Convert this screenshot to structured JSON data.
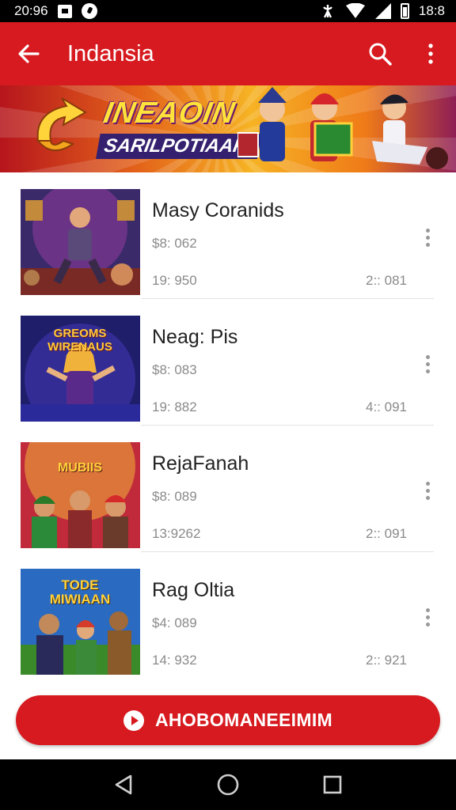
{
  "status_bar": {
    "time_left": "20:96",
    "time_right": "18:8"
  },
  "app_bar": {
    "title": "Indansia",
    "icons": [
      "back-arrow-icon",
      "search-icon",
      "more-vert-icon"
    ]
  },
  "banner": {
    "line1": "INEAOIN",
    "line2": "SARILPOTIAAR!"
  },
  "items": [
    {
      "title": "Masy Coranids",
      "meta": "$8: 062",
      "stat_left": "19: 950",
      "stat_right": "2:: 081",
      "thumb_text": ""
    },
    {
      "title": "Neag: Pis",
      "meta": "$8: 083",
      "stat_left": "19: 882",
      "stat_right": "4:: 091",
      "thumb_text": "GREOMS WIRENAUS"
    },
    {
      "title": "RejaFanah",
      "meta": "$8: 089",
      "stat_left": "13:9262",
      "stat_right": "2:: 091",
      "thumb_text": "MUBIIS"
    },
    {
      "title": "Rag Oltia",
      "meta": "$4: 089",
      "stat_left": "14: 932",
      "stat_right": "2:: 921",
      "thumb_text": "TODE MIWIAAN"
    }
  ],
  "action_button": {
    "label": "AHOBOMANEEIMIM",
    "icon": "play-circle-icon"
  },
  "nav_bar": {
    "icons": [
      "nav-back-icon",
      "nav-home-icon",
      "nav-recents-icon"
    ]
  },
  "colors": {
    "primary": "#d71a1f",
    "banner_yellow": "#f6b324",
    "status_bar": "#000000"
  }
}
